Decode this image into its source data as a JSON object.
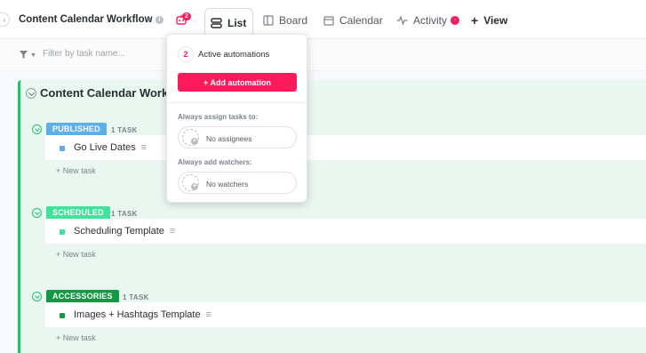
{
  "header": {
    "workspace_title": "Content Calendar Workflow",
    "automation_badge": "2",
    "tabs": [
      {
        "label": "List",
        "icon": "list-icon",
        "active": true
      },
      {
        "label": "Board",
        "icon": "board-icon"
      },
      {
        "label": "Calendar",
        "icon": "calendar-icon"
      },
      {
        "label": "Activity",
        "icon": "activity-icon"
      }
    ],
    "add_view_label": "View"
  },
  "filter": {
    "placeholder": "Filter by task name..."
  },
  "list": {
    "title": "Content Calendar Workflow",
    "groups": [
      {
        "status": "PUBLISHED",
        "color": "#5eaee8",
        "count": "1 TASK",
        "tasks": [
          {
            "name": "Go Live Dates",
            "color": "#5eaee8"
          }
        ],
        "new_task_label": "+ New task"
      },
      {
        "status": "SCHEDULED",
        "color": "#3fe39b",
        "count": "1 TASK",
        "tasks": [
          {
            "name": "Scheduling Template",
            "color": "#3fe39b"
          }
        ],
        "new_task_label": "+ New task"
      },
      {
        "status": "ACCESSORIES",
        "color": "#139944",
        "count": "1 TASK",
        "tasks": [
          {
            "name": "Images + Hashtags Template",
            "color": "#139944"
          }
        ],
        "new_task_label": "+ New task"
      }
    ]
  },
  "automations_popup": {
    "count": "2",
    "active_label": "Active automations",
    "add_button": "+ Add automation",
    "assign_label": "Always assign tasks to:",
    "assign_value": "No assignees",
    "watchers_label": "Always add watchers:",
    "watchers_value": "No watchers"
  },
  "colors": {
    "accent": "#fd1a5b",
    "list_border": "#1dc36b",
    "list_bg": "#eaf7f1"
  }
}
